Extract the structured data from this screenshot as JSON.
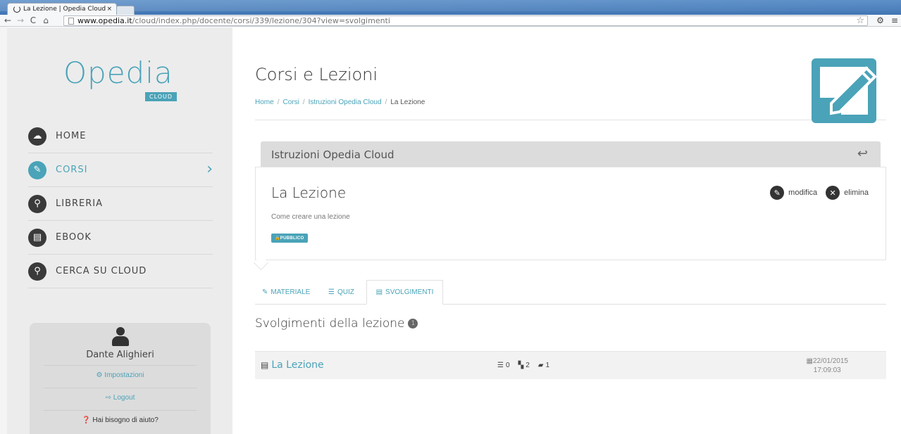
{
  "browser": {
    "tab_title": "La Lezione | Opedia Cloud",
    "tab_close": "×",
    "url_host": "www.opedia.it",
    "url_path": "/cloud/index.php/docente/corsi/339/lezione/304?view=svolgimenti"
  },
  "sidebar": {
    "logo_text": "Opedia",
    "logo_sub": "CLOUD",
    "items": [
      {
        "label": "HOME",
        "icon": "cloud-icon",
        "glyph": "☁"
      },
      {
        "label": "CORSI",
        "icon": "edit-icon",
        "glyph": "✎"
      },
      {
        "label": "LIBRERIA",
        "icon": "paperclip-icon",
        "glyph": "⚲"
      },
      {
        "label": "EBOOK",
        "icon": "book-icon",
        "glyph": "▤"
      },
      {
        "label": "CERCA SU CLOUD",
        "icon": "search-icon",
        "glyph": "⚲"
      }
    ],
    "active_chevron": "›",
    "user": {
      "name": "Dante Alighieri",
      "settings": "Impostazioni",
      "logout": "Logout",
      "help": "Hai bisogno di aiuto?"
    }
  },
  "main": {
    "title": "Corsi e Lezioni",
    "breadcrumb": [
      "Home",
      "Corsi",
      "Istruzioni Opedia Cloud",
      "La Lezione"
    ],
    "course_name": "Istruzioni Opedia Cloud",
    "lesson": {
      "title": "La Lezione",
      "subtitle": "Come creare una lezione",
      "badge": "PUBBLICO",
      "edit_label": "modifica",
      "delete_label": "elimina"
    },
    "tabs": [
      {
        "label": "MATERIALE"
      },
      {
        "label": "QUIZ"
      },
      {
        "label": "SVOLGIMENTI"
      }
    ],
    "section_title": "Svolgimenti della lezione",
    "section_count": "1",
    "result": {
      "name": "La Lezione",
      "quiz_count": "0",
      "doc_count": "2",
      "book_count": "1",
      "date": "22/01/2015",
      "time": "17:09:03"
    }
  },
  "colors": {
    "accent": "#4aa3b8",
    "sidebar_bg": "#ececec",
    "dark_icon": "#3a3a3a"
  }
}
